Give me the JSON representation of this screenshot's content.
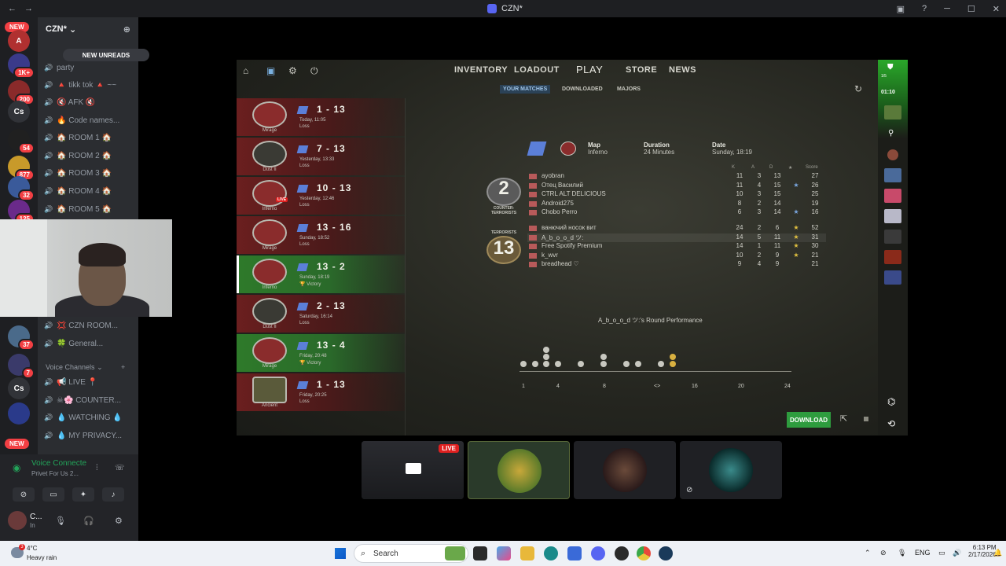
{
  "window": {
    "title": "CZN*",
    "nav_back": "←",
    "nav_forward": "→"
  },
  "servers": {
    "new_top": "NEW",
    "badges": [
      "1K+",
      "200",
      "54",
      "877",
      "32",
      "125",
      "37",
      "7"
    ],
    "cs_label": "Cs",
    "new_bottom": "NEW"
  },
  "sidebar": {
    "guild_name": "CZN*",
    "new_unreads": "NEW UNREADS",
    "channels": [
      "party",
      "🔺 tikk tok 🔺 ~~",
      "🔇 AFK 🔇",
      "🔥 Code names...",
      "🏠 ROOM 1 🏠",
      "🏠 ROOM 2 🏠",
      "🏠 ROOM 3 🏠",
      "🏠 ROOM 4 🏠",
      "🏠 ROOM 5 🏠",
      "💢 CZN ROOM...",
      "🍀 General...",
      "📢 LIVE 📍",
      "☠🌸 COUNTER...",
      "💧 WATCHING 💧",
      "💧 MY PRIVACY..."
    ],
    "voice_channels_label": "Voice Channels"
  },
  "user_panel": {
    "voice_connected": "Voice Connecte",
    "voice_sub": "Privet For Us 2...",
    "username": "C...",
    "status": "In"
  },
  "cs": {
    "nav": {
      "inventory": "INVENTORY",
      "loadout": "LOADOUT",
      "play": "PLAY",
      "store": "STORE",
      "news": "NEWS"
    },
    "subtabs": {
      "your_matches": "YOUR MATCHES",
      "downloaded": "DOWNLOADED",
      "majors": "MAJORS"
    },
    "matches": [
      {
        "map": "Mirage",
        "score_a": "1",
        "score_b": "13",
        "date": "Today, 11:05",
        "result": "Loss"
      },
      {
        "map": "Dust II",
        "score_a": "7",
        "score_b": "13",
        "date": "Yesterday, 13:33",
        "result": "Loss"
      },
      {
        "map": "Inferno",
        "score_a": "10",
        "score_b": "13",
        "date": "Yesterday, 12:46",
        "result": "Loss"
      },
      {
        "map": "Mirage",
        "score_a": "13",
        "score_b": "16",
        "date": "Sunday, 18:52",
        "result": "Loss"
      },
      {
        "map": "Inferno",
        "score_a": "13",
        "score_b": "2",
        "date": "Sunday, 18:19",
        "result": "Victory"
      },
      {
        "map": "Dust II",
        "score_a": "2",
        "score_b": "13",
        "date": "Saturday, 16:14",
        "result": "Loss"
      },
      {
        "map": "Mirage",
        "score_a": "13",
        "score_b": "4",
        "date": "Friday, 20:48",
        "result": "Victory"
      },
      {
        "map": "Ancient",
        "score_a": "1",
        "score_b": "13",
        "date": "Friday, 20:25",
        "result": "Loss"
      }
    ],
    "live_tag": "LIVE",
    "detail": {
      "map_label": "Map",
      "map_value": "Inferno",
      "duration_label": "Duration",
      "duration_value": "24 Minutes",
      "date_label": "Date",
      "date_value": "Sunday, 18:19"
    },
    "teams": {
      "ct_score": "2",
      "ct_label": "COUNTER-TERRORISTS",
      "t_score": "13",
      "t_label": "TERRORISTS"
    },
    "stat_headers": {
      "k": "K",
      "a": "A",
      "d": "D",
      "star": "★",
      "score": "Score"
    },
    "ct_players": [
      {
        "name": "ayobran",
        "k": "11",
        "a": "3",
        "d": "13",
        "mvp": "",
        "score": "27"
      },
      {
        "name": "Отец Василий",
        "k": "11",
        "a": "4",
        "d": "15",
        "mvp": "★",
        "score": "26"
      },
      {
        "name": "CTRL ALT DELICIOUS",
        "k": "10",
        "a": "3",
        "d": "15",
        "mvp": "",
        "score": "25"
      },
      {
        "name": "Android275",
        "k": "8",
        "a": "2",
        "d": "14",
        "mvp": "",
        "score": "19"
      },
      {
        "name": "Chobo Perro",
        "k": "6",
        "a": "3",
        "d": "14",
        "mvp": "★",
        "score": "16"
      }
    ],
    "t_players": [
      {
        "name": "ванючий носок вит",
        "k": "24",
        "a": "2",
        "d": "6",
        "mvp": "★",
        "score": "52"
      },
      {
        "name": "A_b_o_o_d ツ:",
        "k": "14",
        "a": "5",
        "d": "11",
        "mvp": "★",
        "score": "31"
      },
      {
        "name": "Free Spotify Premium",
        "k": "14",
        "a": "1",
        "d": "11",
        "mvp": "★",
        "score": "30"
      },
      {
        "name": "k_wvr",
        "k": "10",
        "a": "2",
        "d": "9",
        "mvp": "★",
        "score": "21"
      },
      {
        "name": "breadhead ♡",
        "k": "9",
        "a": "4",
        "d": "9",
        "mvp": "",
        "score": "21"
      }
    ],
    "round_performance_title": "A_b_o_o_d ツ:'s Round Performance",
    "round_ticks": [
      "1",
      "4",
      "8",
      "<>",
      "16",
      "20",
      "24"
    ],
    "download_label": "DOWNLOAD",
    "friends": {
      "count": "1/5",
      "time": "01:10"
    }
  },
  "stream_thumbs": {
    "live_tag": "LIVE"
  },
  "taskbar": {
    "temp": "4°C",
    "condition": "Heavy rain",
    "weather_badge": "3",
    "search_placeholder": "Search",
    "lang": "ENG",
    "time": "6:13 PM",
    "date": "2/17/2026"
  }
}
